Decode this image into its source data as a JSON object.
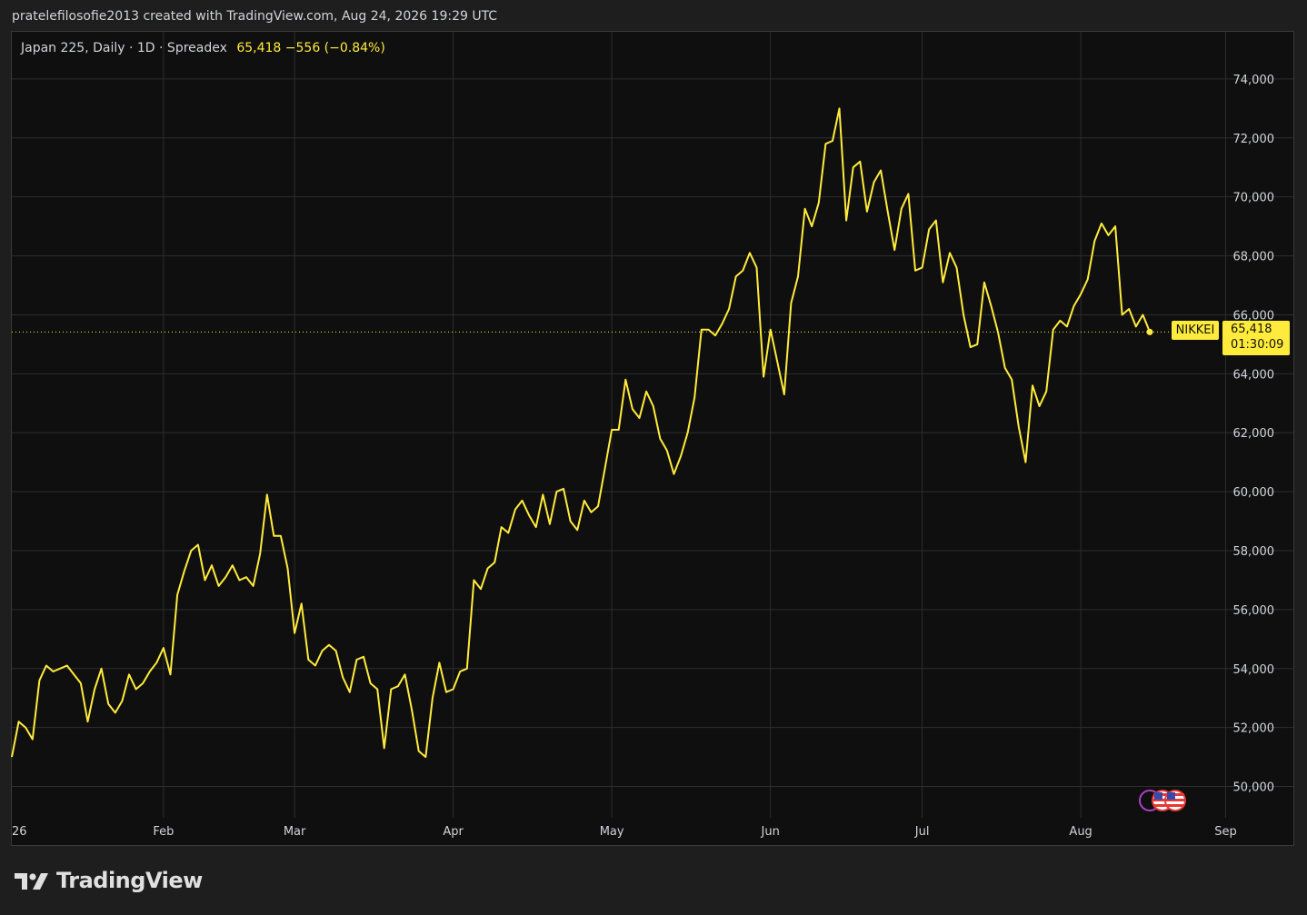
{
  "header": {
    "caption": "pratelefilosofie2013 created with TradingView.com, Aug 24, 2026 19:29 UTC"
  },
  "legend": {
    "symbol_info": "Japan 225, Daily · 1D · Spreadex",
    "price_change": "65,418  −556 (−0.84%)"
  },
  "price_tag": {
    "name": "NIKKEI",
    "price": "65,418",
    "countdown": "01:30:09"
  },
  "brand": {
    "name": "TradingView"
  },
  "colors": {
    "line": "#ffeb3b",
    "background": "#0f0f0f",
    "grid": "#2e2e2e",
    "axis_text": "#d1d4dc"
  },
  "icons": {
    "logo": "tradingview-logo-icon",
    "flags": "us-flag-icon"
  },
  "chart_data": {
    "type": "line",
    "series": [
      {
        "values": [
          51000,
          52200,
          52000,
          51600,
          53600,
          54100,
          53900,
          54000,
          54100,
          53800,
          53500,
          52200,
          53300,
          54000,
          52800,
          52500,
          52900,
          53800,
          53300,
          53500,
          53900,
          54200,
          54700,
          53800,
          56500,
          57300,
          58000,
          58200,
          57000,
          57500,
          56800,
          57100,
          57500,
          57000,
          57100,
          56800,
          57900,
          59900,
          58500,
          58500,
          57400,
          55200,
          56200,
          54300,
          54100,
          54600,
          54800,
          54600,
          53700,
          53200,
          54300,
          54400,
          53500,
          53300,
          51300,
          53300,
          53400,
          53800,
          52600,
          51200,
          51000,
          53000,
          54200,
          53200,
          53300,
          53900,
          54000,
          57000,
          56700,
          57400,
          57600,
          58800,
          58600,
          59400,
          59700,
          59200,
          58800,
          59900,
          58900,
          60000,
          60100,
          59000,
          58700,
          59700,
          59300,
          59500,
          60800,
          62100,
          62100,
          63800,
          62800,
          62500,
          63400,
          62900,
          61800,
          61400,
          60600,
          61200,
          62000,
          63200,
          65500,
          65500,
          65300,
          65700,
          66200,
          67300,
          67500,
          68100,
          67600,
          63900,
          65500,
          64400,
          63300,
          66400,
          67300,
          69600,
          69000,
          69800,
          71800,
          71900,
          73000,
          69200,
          71000,
          71200,
          69500,
          70500,
          70900,
          69500,
          68200,
          69600,
          70100,
          67500,
          67600,
          68900,
          69200,
          67100,
          68100,
          67600,
          66000,
          64900,
          65000,
          67100,
          66300,
          65400,
          64200,
          63800,
          62200,
          61000,
          63600,
          62900,
          63400,
          65500,
          65800,
          65600,
          66300,
          66700,
          67200,
          68500,
          69100,
          68700,
          69000,
          66000,
          66200,
          65600,
          66000,
          65418
        ]
      }
    ],
    "x_labels": [
      "26",
      "Feb",
      "Mar",
      "Apr",
      "May",
      "Jun",
      "Jul",
      "Aug",
      "Sep"
    ],
    "x_label_index": [
      0,
      22,
      41,
      64,
      87,
      110,
      132,
      155,
      176
    ],
    "ylim": [
      49000,
      75600
    ],
    "y_ticks": [
      50000,
      52000,
      54000,
      56000,
      58000,
      60000,
      62000,
      64000,
      66000,
      68000,
      70000,
      72000,
      74000
    ],
    "y_tick_labels": [
      "50,000",
      "52,000",
      "54,000",
      "56,000",
      "58,000",
      "60,000",
      "62,000",
      "64,000",
      "66,000",
      "68,000",
      "70,000",
      "72,000",
      "74,000"
    ],
    "last_price": 65418,
    "grid": true
  }
}
